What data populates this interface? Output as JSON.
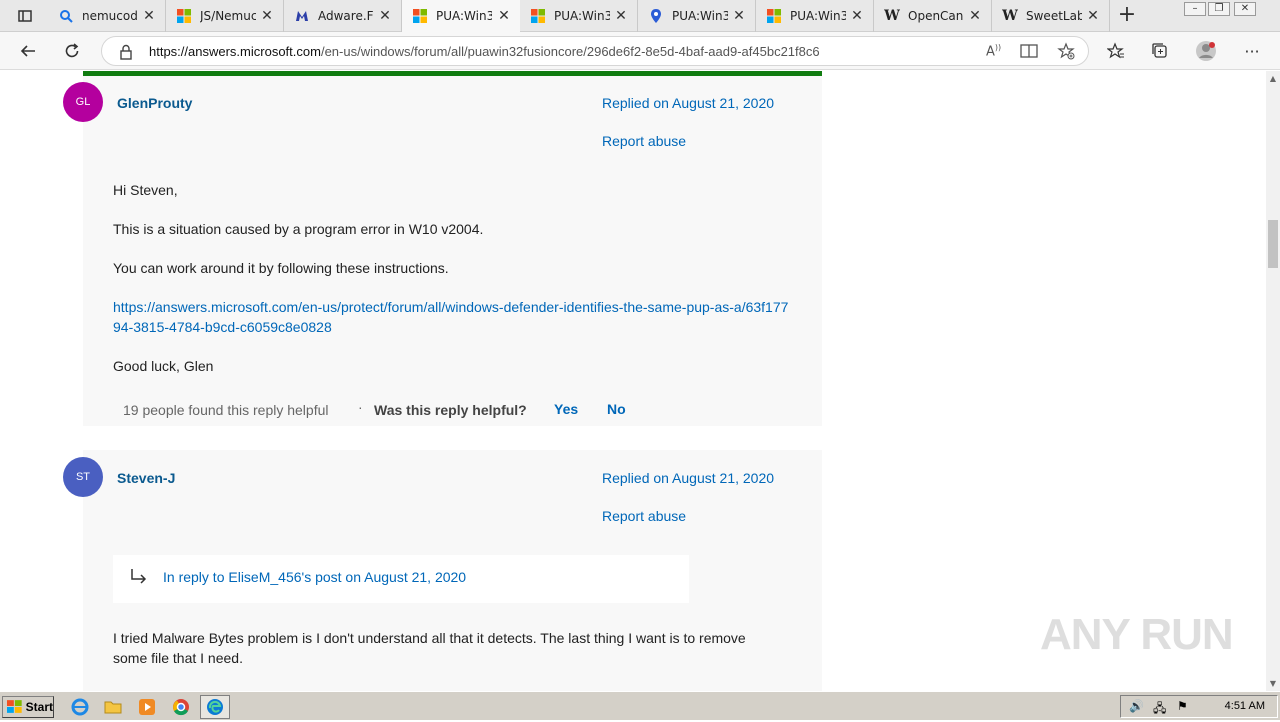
{
  "browser": {
    "tabs": [
      {
        "title": "nemucod",
        "icon": "search-icon",
        "active": false
      },
      {
        "title": "JS/Nemuc",
        "icon": "microsoft-logo-icon",
        "active": false
      },
      {
        "title": "Adware.F",
        "icon": "malwarebytes-icon",
        "active": false
      },
      {
        "title": "PUA:Win3",
        "icon": "microsoft-logo-icon",
        "active": true
      },
      {
        "title": "PUA:Win3",
        "icon": "microsoft-logo-icon",
        "active": false
      },
      {
        "title": "PUA:Win3",
        "icon": "location-pin-icon",
        "active": false
      },
      {
        "title": "PUA:Win3",
        "icon": "microsoft-logo-icon",
        "active": false
      },
      {
        "title": "OpenCan",
        "icon": "wikipedia-icon",
        "active": false
      },
      {
        "title": "SweetLab",
        "icon": "wikipedia-icon",
        "active": false
      }
    ],
    "url_host": "https://answers.microsoft.com",
    "url_path": "/en-us/windows/forum/all/puawin32fusioncore/296de6f2-8e5d-4baf-aad9-af45bc21f8c6"
  },
  "posts": [
    {
      "initials": "GL",
      "avatar_color": "#b4009e",
      "author": "GlenProuty",
      "replied": "Replied on August 21, 2020",
      "report": "Report abuse",
      "greeting": "Hi Steven,",
      "line1": "This is a situation caused by a program error in W10 v2004.",
      "line2": "You can work around it by following these instructions.",
      "link": "https://answers.microsoft.com/en-us/protect/forum/all/windows-defender-identifies-the-same-pup-as-a/63f17794-3815-4784-b9cd-c6059c8e0828",
      "signoff": "Good luck,  Glen",
      "helpful_count": "19 people found this reply helpful",
      "separator": "·",
      "helpful_question": "Was this reply helpful?",
      "yes": "Yes",
      "no": "No"
    },
    {
      "initials": "ST",
      "avatar_color": "#4a5fc1",
      "author": "Steven-J",
      "replied": "Replied on August 21, 2020",
      "report": "Report abuse",
      "in_reply": "In reply to EliseM_456's post on August 21, 2020",
      "body": "I tried Malware Bytes problem is I don't understand all that it detects.  The last thing I want is to remove some file that I need."
    }
  ],
  "taskbar": {
    "start": "Start",
    "clock": "4:51 AM",
    "watermark": "ANY RUN"
  }
}
